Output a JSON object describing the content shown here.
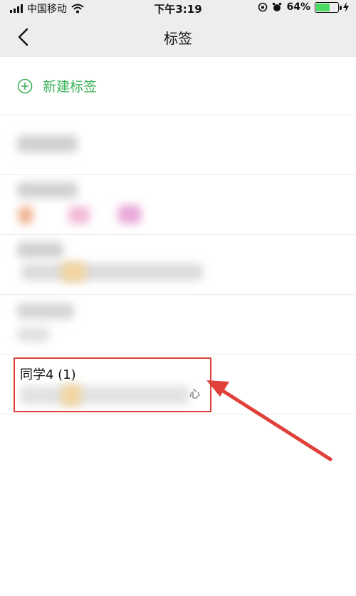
{
  "status_bar": {
    "carrier": "中国移动",
    "time": "下午3:19",
    "battery": "64%",
    "battery_level": 0.64
  },
  "nav": {
    "title": "标签",
    "back_icon": "chevron-left-icon"
  },
  "new_tag": {
    "label": "新建标签",
    "icon": "plus-circle-icon",
    "color": "#3cb35a"
  },
  "tags": [
    {
      "name": "同学4 (1)",
      "members_tail": "心"
    }
  ],
  "colors": {
    "highlight": "#e0403a",
    "arrow": "#e0403a",
    "nav_bg": "#ededed"
  }
}
